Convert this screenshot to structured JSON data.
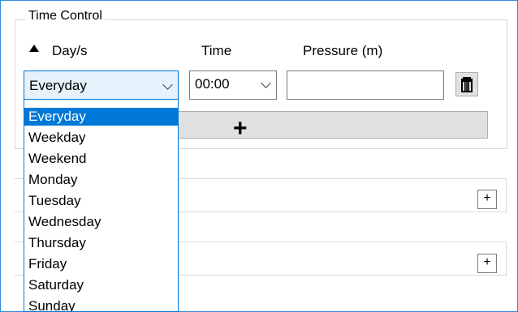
{
  "time_control": {
    "title": "Time Control",
    "headers": {
      "days": "Day/s",
      "time": "Time",
      "pressure": "Pressure (m)"
    },
    "day_combo": {
      "selected": "Everyday"
    },
    "time_combo": {
      "selected": "00:00"
    },
    "pressure_input": {
      "value": ""
    },
    "add_row_label": "+",
    "day_options": [
      "Everyday",
      "Weekday",
      "Weekend",
      "Monday",
      "Tuesday",
      "Wednesday",
      "Thursday",
      "Friday",
      "Saturday",
      "Sunday"
    ],
    "selected_option": "Everyday"
  },
  "sections": [
    {
      "add_label": "+"
    },
    {
      "add_label": "+"
    }
  ],
  "icons": {
    "sort": "sort-up-icon",
    "delete": "trash-icon",
    "dropdown": "chevron-down-icon"
  },
  "colors": {
    "accent": "#0078d7",
    "frame": "#2f8be0"
  }
}
